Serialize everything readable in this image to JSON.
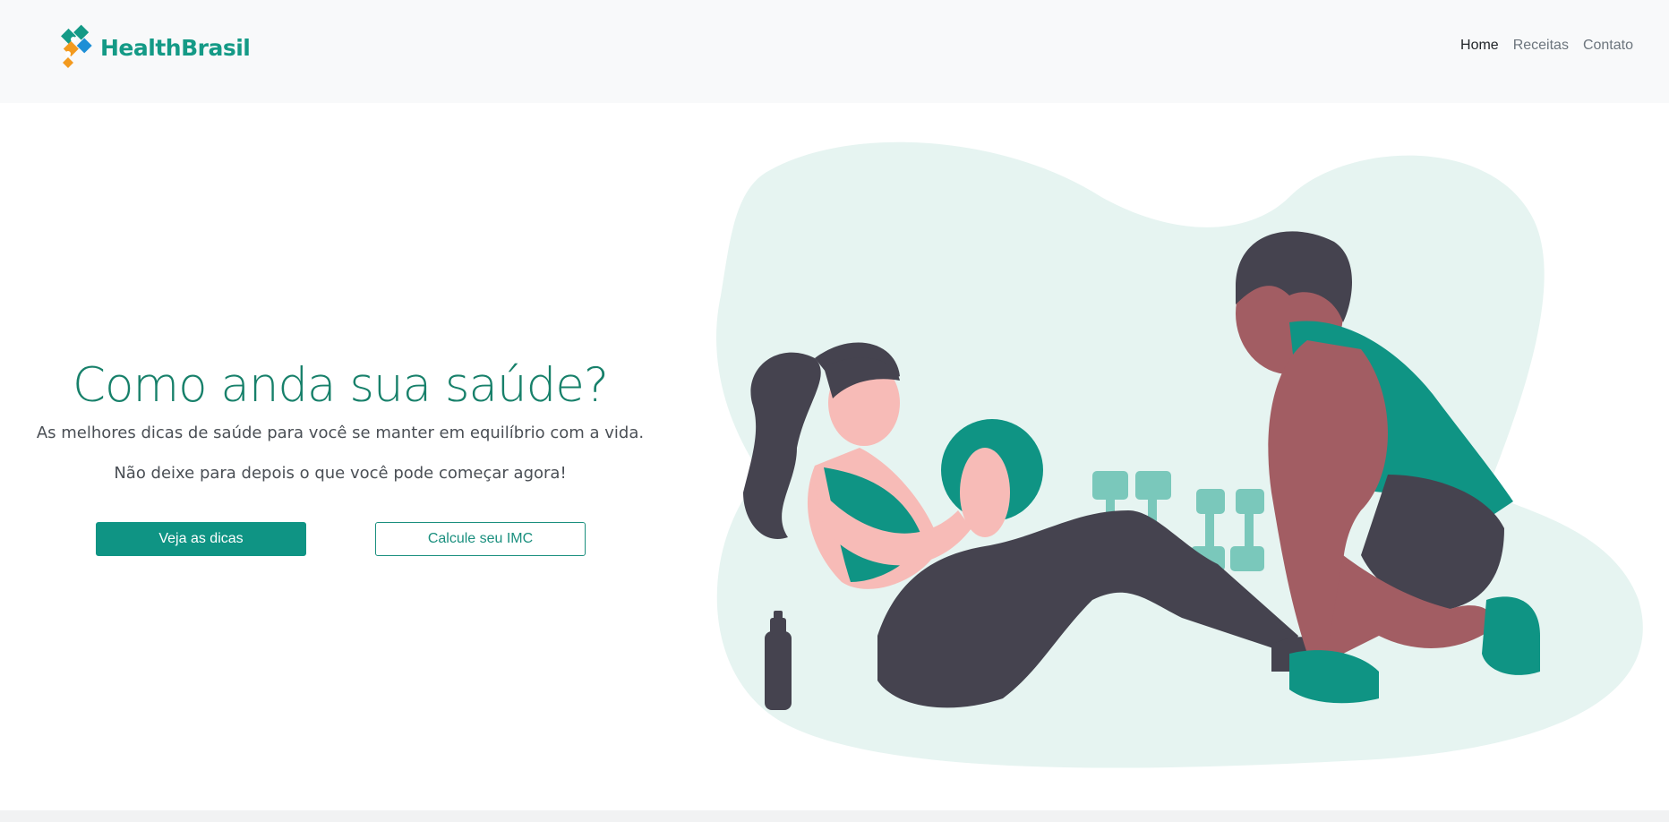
{
  "brand": {
    "name": "HealthBrasil",
    "logo_icon": "healthbrasil-logo-icon"
  },
  "nav": {
    "items": [
      {
        "label": "Home",
        "active": true
      },
      {
        "label": "Receitas",
        "active": false
      },
      {
        "label": "Contato",
        "active": false
      }
    ]
  },
  "hero": {
    "title": "Como anda sua saúde?",
    "subtitle": "As melhores dicas de saúde para você se manter em equilíbrio com a vida.",
    "subtitle2": "Não deixe para depois o que você pode começar agora!",
    "primary_button": "Veja as dicas",
    "secondary_button": "Calcule seu IMC"
  },
  "colors": {
    "brand": "#149a86",
    "accent_teal": "#0f9484",
    "title": "#17806a",
    "navbar_bg": "#f8f9fa",
    "blob_bg": "#e6f4f1"
  },
  "illustration": {
    "icon": "fitness-workout-illustration"
  }
}
